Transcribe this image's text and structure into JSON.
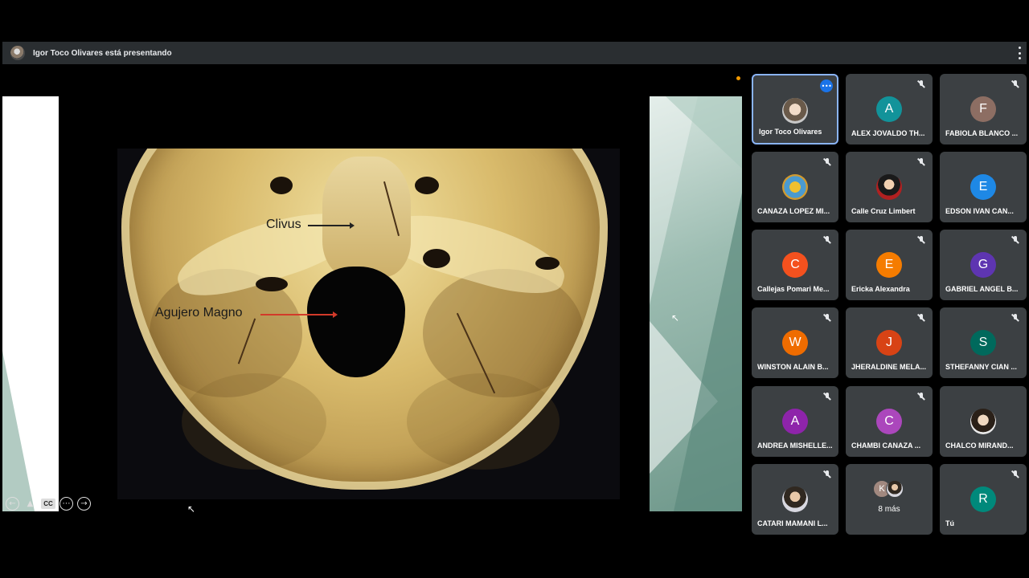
{
  "presenter_bar": {
    "text": "Igor Toco Olivares está presentando",
    "avatar_icon": "presenter-avatar"
  },
  "slide": {
    "label_clivus": "Clivus",
    "label_agujero": "Agujero Magno",
    "controls": [
      "arrow-left-icon",
      "pointer-icon",
      "cc-icon",
      "more-icon",
      "arrow-right-icon"
    ],
    "cc_text": "CC"
  },
  "participants": [
    {
      "name": "Igor Toco Olivares",
      "initial": "",
      "color": "",
      "photo": true,
      "active": true,
      "muted": false
    },
    {
      "name": "ALEX JOVALDO TH...",
      "initial": "A",
      "color": "#12939a",
      "muted": true
    },
    {
      "name": "FABIOLA BLANCO ...",
      "initial": "F",
      "color": "#8d6e63",
      "muted": true
    },
    {
      "name": "CANAZA LOPEZ MI...",
      "initial": "",
      "color": "",
      "photo": true,
      "muted": true
    },
    {
      "name": "Calle Cruz Limbert",
      "initial": "",
      "color": "",
      "photo": true,
      "muted": true
    },
    {
      "name": "EDSON IVAN CAN...",
      "initial": "E",
      "color": "#1e88e5",
      "muted": false
    },
    {
      "name": "Callejas Pomari Me...",
      "initial": "C",
      "color": "#f4511e",
      "muted": true
    },
    {
      "name": "Ericka Alexandra",
      "initial": "E",
      "color": "#f57c00",
      "muted": true
    },
    {
      "name": "GABRIEL ANGEL B...",
      "initial": "G",
      "color": "#5e35b1",
      "muted": true
    },
    {
      "name": "WINSTON ALAIN B...",
      "initial": "W",
      "color": "#ef6c00",
      "muted": true
    },
    {
      "name": "JHERALDINE MELA...",
      "initial": "J",
      "color": "#d84315",
      "muted": true
    },
    {
      "name": "STHEFANNY CIAN ...",
      "initial": "S",
      "color": "#00695c",
      "muted": true
    },
    {
      "name": "ANDREA MISHELLE...",
      "initial": "A",
      "color": "#8e24aa",
      "muted": true
    },
    {
      "name": "CHAMBI CANAZA ...",
      "initial": "C",
      "color": "#ab47bc",
      "muted": true
    },
    {
      "name": "CHALCO MIRAND...",
      "initial": "",
      "color": "",
      "photo": true,
      "muted": false
    },
    {
      "name": "CATARI MAMANI L...",
      "initial": "",
      "color": "",
      "photo": true,
      "muted": true
    },
    {
      "name": "8 más",
      "initial": "K",
      "color": "#a1887f",
      "more": true,
      "muted": false
    },
    {
      "name": "Tú",
      "initial": "R",
      "color": "#00897b",
      "muted": true
    }
  ]
}
